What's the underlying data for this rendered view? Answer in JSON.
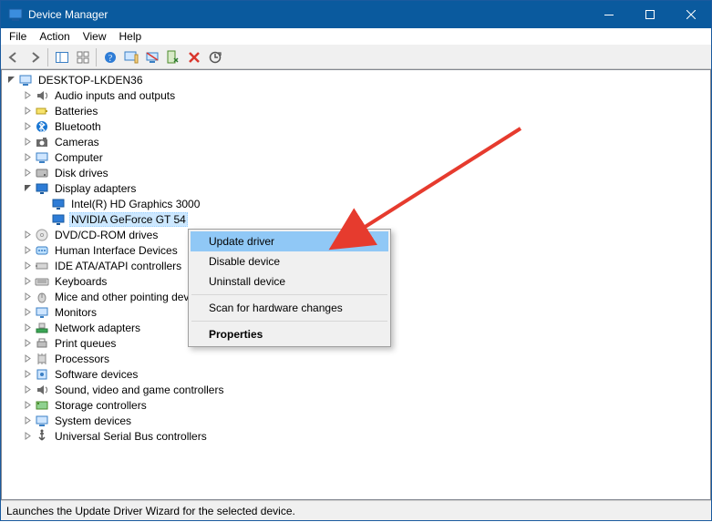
{
  "titlebar": {
    "title": "Device Manager"
  },
  "menubar": {
    "items": [
      "File",
      "Action",
      "View",
      "Help"
    ]
  },
  "toolbar_buttons": [
    "back",
    "forward",
    "show-hide-tree",
    "properties-sheet",
    "help",
    "tb-update",
    "tb-monitor",
    "tb-enable",
    "tb-uninstall",
    "tb-scan"
  ],
  "tree": {
    "root": {
      "label": "DESKTOP-LKDEN36",
      "expanded": true
    },
    "categories": [
      {
        "id": "audio",
        "label": "Audio inputs and outputs",
        "expanded": false,
        "children": []
      },
      {
        "id": "batteries",
        "label": "Batteries",
        "expanded": false,
        "children": []
      },
      {
        "id": "bluetooth",
        "label": "Bluetooth",
        "expanded": false,
        "children": []
      },
      {
        "id": "cameras",
        "label": "Cameras",
        "expanded": false,
        "children": []
      },
      {
        "id": "computer",
        "label": "Computer",
        "expanded": false,
        "children": []
      },
      {
        "id": "disk",
        "label": "Disk drives",
        "expanded": false,
        "children": []
      },
      {
        "id": "display",
        "label": "Display adapters",
        "expanded": true,
        "children": [
          {
            "id": "intel-hd-3000",
            "label": "Intel(R) HD Graphics 3000",
            "selected": false
          },
          {
            "id": "nvidia-gt-54",
            "label": "NVIDIA GeForce GT 54",
            "selected": true
          }
        ]
      },
      {
        "id": "dvd",
        "label": "DVD/CD-ROM drives",
        "expanded": false,
        "children": []
      },
      {
        "id": "hid",
        "label": "Human Interface Devices",
        "expanded": false,
        "children": []
      },
      {
        "id": "ide",
        "label": "IDE ATA/ATAPI controllers",
        "expanded": false,
        "children": []
      },
      {
        "id": "keyboards",
        "label": "Keyboards",
        "expanded": false,
        "children": []
      },
      {
        "id": "mice",
        "label": "Mice and other pointing devices",
        "expanded": false,
        "children": []
      },
      {
        "id": "monitors",
        "label": "Monitors",
        "expanded": false,
        "children": []
      },
      {
        "id": "network",
        "label": "Network adapters",
        "expanded": false,
        "children": []
      },
      {
        "id": "printq",
        "label": "Print queues",
        "expanded": false,
        "children": []
      },
      {
        "id": "cpu",
        "label": "Processors",
        "expanded": false,
        "children": []
      },
      {
        "id": "softdev",
        "label": "Software devices",
        "expanded": false,
        "children": []
      },
      {
        "id": "sound",
        "label": "Sound, video and game controllers",
        "expanded": false,
        "children": []
      },
      {
        "id": "storage",
        "label": "Storage controllers",
        "expanded": false,
        "children": []
      },
      {
        "id": "sysdev",
        "label": "System devices",
        "expanded": false,
        "children": []
      },
      {
        "id": "usb",
        "label": "Universal Serial Bus controllers",
        "expanded": false,
        "children": []
      }
    ]
  },
  "context_menu": {
    "items": [
      {
        "label": "Update driver",
        "highlight": true
      },
      {
        "label": "Disable device",
        "highlight": false
      },
      {
        "label": "Uninstall device",
        "highlight": false
      },
      {
        "sep": true
      },
      {
        "label": "Scan for hardware changes",
        "highlight": false
      },
      {
        "sep": true
      },
      {
        "label": "Properties",
        "highlight": false,
        "bold": true
      }
    ]
  },
  "statusbar": {
    "text": "Launches the Update Driver Wizard for the selected device."
  }
}
